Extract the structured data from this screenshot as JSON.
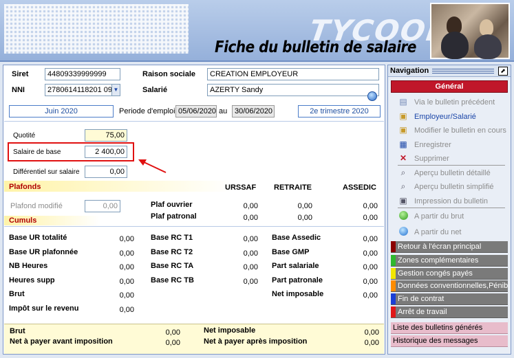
{
  "header": {
    "brand": "TYCOON",
    "title": "Fiche du bulletin de salaire"
  },
  "form": {
    "siret_label": "Siret",
    "siret_value": "44809339999999",
    "raison_label": "Raison sociale",
    "raison_value": "CREATION EMPLOYEUR",
    "nni_label": "NNI",
    "nni_value": "2780614118201 09",
    "salarie_label": "Salarié",
    "salarie_value": "AZERTY Sandy",
    "period_month": "Juin 2020",
    "periode_label": "Periode d'emploi",
    "period_start": "05/06/2020",
    "au_label": "au",
    "period_end": "30/06/2020",
    "trimestre": "2e trimestre 2020",
    "quotite_label": "Quotité",
    "quotite_value": "75,00",
    "salaire_label": "Salaire de base",
    "salaire_value": "2 400,00",
    "diff_label": "Différentiel sur salaire",
    "diff_value": "0,00"
  },
  "plafonds": {
    "title": "Plafonds",
    "col_urssaf": "URSSAF",
    "col_retraite": "RETRAITE",
    "col_assedic": "ASSEDIC",
    "plafond_modifie_label": "Plafond modifié",
    "plafond_modifie_value": "0,00",
    "rows": [
      {
        "label": "Plaf ouvrier",
        "urssaf": "0,00",
        "retraite": "0,00",
        "assedic": "0,00"
      },
      {
        "label": "Plaf patronal",
        "urssaf": "0,00",
        "retraite": "0,00",
        "assedic": "0,00"
      }
    ]
  },
  "cumuls": {
    "title": "Cumuls",
    "col1": [
      {
        "label": "Base UR totalité",
        "value": "0,00"
      },
      {
        "label": "Base UR plafonnée",
        "value": "0,00"
      },
      {
        "label": "NB Heures",
        "value": "0,00"
      },
      {
        "label": "Heures supp",
        "value": "0,00"
      },
      {
        "label": "Brut",
        "value": "0,00"
      },
      {
        "label": "Impôt sur le revenu",
        "value": "0,00"
      }
    ],
    "col2": [
      {
        "label": "Base RC T1",
        "value": "0,00"
      },
      {
        "label": "Base RC T2",
        "value": "0,00"
      },
      {
        "label": "Base RC TA",
        "value": "0,00"
      },
      {
        "label": "Base RC TB",
        "value": "0,00"
      }
    ],
    "col3": [
      {
        "label": "Base Assedic",
        "value": "0,00"
      },
      {
        "label": "Base GMP",
        "value": "0,00"
      },
      {
        "label": "Part salariale",
        "value": "0,00"
      },
      {
        "label": "Part patronale",
        "value": "0,00"
      },
      {
        "label": "Net imposable",
        "value": "0,00"
      }
    ]
  },
  "footer": {
    "brut_label": "Brut",
    "brut_value": "0,00",
    "net_avant_label": "Net à payer avant imposition",
    "net_avant_value": "0,00",
    "net_imposable_label": "Net imposable",
    "net_imposable_value": "0,00",
    "net_apres_label": "Net à payer après imposition",
    "net_apres_value": "0,00"
  },
  "navigation": {
    "title": "Navigation",
    "section": "Général",
    "items": [
      {
        "label": "Via le bulletin précédent",
        "icon": "document-icon"
      },
      {
        "label": "Employeur/Salarié",
        "icon": "printer-icon"
      },
      {
        "label": "Modifier le bulletin en cours",
        "icon": "printer-icon"
      },
      {
        "label": "Enregistrer",
        "icon": "save-icon"
      },
      {
        "label": "Supprimer",
        "icon": "delete-icon"
      },
      {
        "label": "Aperçu bulletin détaillé",
        "icon": "preview-icon"
      },
      {
        "label": "Aperçu bulletin simplifié",
        "icon": "zoom-icon"
      },
      {
        "label": "Impression du bulletin",
        "icon": "printer-icon"
      },
      {
        "label": "A partir du brut",
        "icon": "green-circle-icon"
      },
      {
        "label": "A partir du net",
        "icon": "blue-circle-icon"
      }
    ],
    "grey_items": [
      {
        "label": "Retour à l'écran principal",
        "color": "#8b0000"
      },
      {
        "label": "Zones complémentaires",
        "color": "#2eb82e"
      },
      {
        "label": "Gestion congés payés",
        "color": "#f2e600"
      },
      {
        "label": "Données conventionnelles,Pénibilité",
        "color": "#ff8c00"
      },
      {
        "label": "Fin de contrat",
        "color": "#1a3fd6"
      },
      {
        "label": "Arrêt de travail",
        "color": "#e01818"
      }
    ],
    "pink_items": [
      {
        "label": "Liste des bulletins générés"
      },
      {
        "label": "Historique des messages"
      }
    ]
  }
}
